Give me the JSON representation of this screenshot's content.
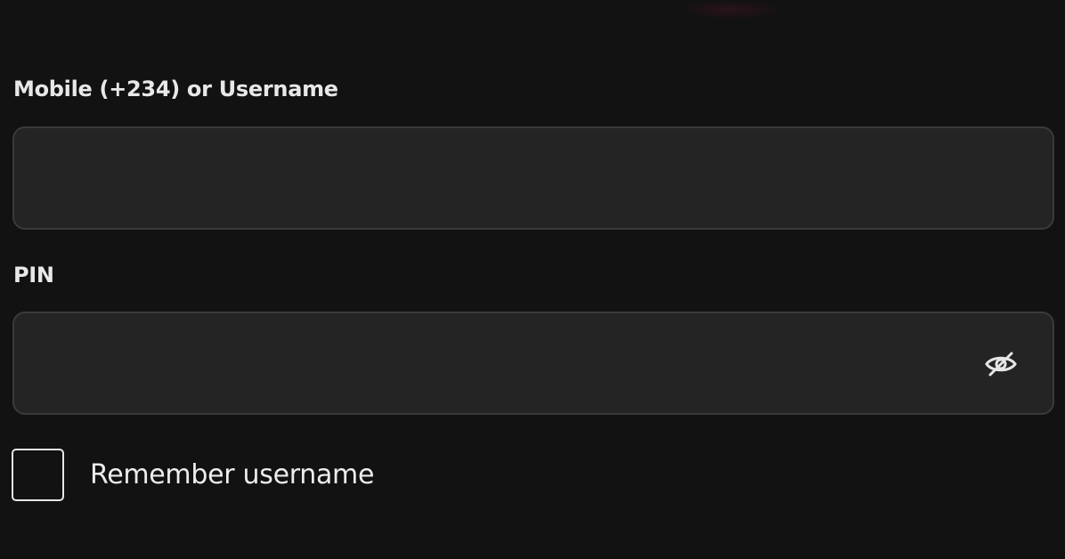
{
  "form": {
    "username": {
      "label": "Mobile (+234) or Username",
      "value": "",
      "placeholder": ""
    },
    "pin": {
      "label": "PIN",
      "value": "",
      "placeholder": "",
      "toggle_icon": "eye-slash-icon"
    },
    "remember": {
      "label": "Remember username",
      "checked": false
    }
  },
  "colors": {
    "background": "#121212",
    "input_background": "#242424",
    "input_border": "#3a3a3a",
    "text": "#e8e8e8"
  }
}
